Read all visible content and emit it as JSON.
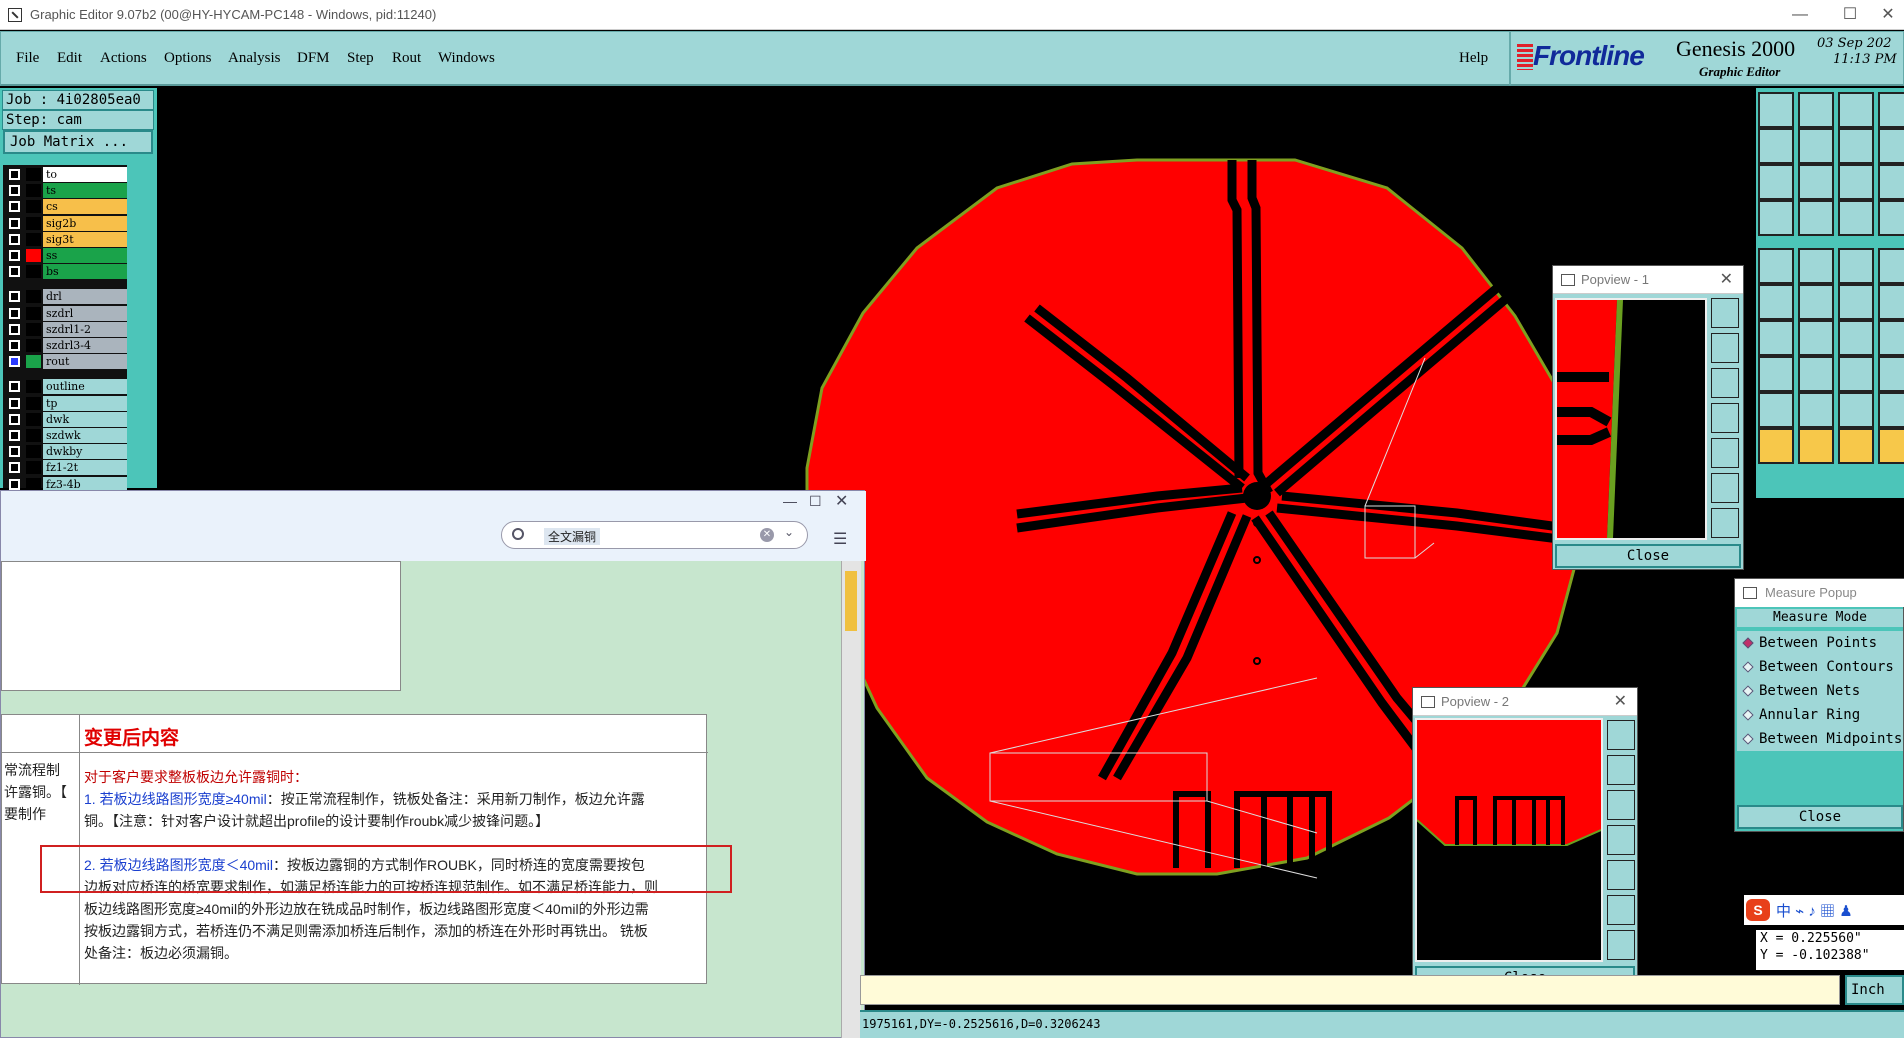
{
  "window": {
    "title": "Graphic Editor 9.07b2 (00@HY-HYCAM-PC148 - Windows, pid:11240)"
  },
  "menu": [
    "File",
    "Edit",
    "Actions",
    "Options",
    "Analysis",
    "DFM",
    "Step",
    "Rout",
    "Windows"
  ],
  "help": "Help",
  "brand": {
    "logo": "Frontline",
    "product": "Genesis 2000",
    "subtitle": "Graphic Editor",
    "date": "03 Sep 202",
    "time": "11:13 PM"
  },
  "job": {
    "job_line": "Job : 4i02805ea0",
    "step_line": "Step: cam",
    "matrix_label": "Job Matrix ..."
  },
  "layers": [
    {
      "name": "to",
      "color": "#ffffff",
      "active": false
    },
    {
      "name": "ts",
      "color": "#1aa34a",
      "active": false
    },
    {
      "name": "cs",
      "color": "#f7bf4a",
      "active": false
    },
    {
      "name": "sig2b",
      "color": "#f7bf4a",
      "active": false
    },
    {
      "name": "sig3t",
      "color": "#f7bf4a",
      "active": false
    },
    {
      "name": "ss",
      "color": "#1aa34a",
      "active": true,
      "marker": "#ff0000"
    },
    {
      "name": "bs",
      "color": "#1aa34a",
      "active": false
    },
    {
      "name": "drl",
      "color": "#aab4bd",
      "active": false
    },
    {
      "name": "szdrl",
      "color": "#aab4bd",
      "active": false
    },
    {
      "name": "szdrl1-2",
      "color": "#aab4bd",
      "active": false
    },
    {
      "name": "szdrl3-4",
      "color": "#aab4bd",
      "active": false
    },
    {
      "name": "rout",
      "color": "#aab4bd",
      "active": true,
      "marker": "#1aa34a"
    },
    {
      "name": "outline",
      "color": "#9fd7d7",
      "active": false
    },
    {
      "name": "tp",
      "color": "#9fd7d7",
      "active": false
    },
    {
      "name": "dwk",
      "color": "#9fd7d7",
      "active": false
    },
    {
      "name": "szdwk",
      "color": "#9fd7d7",
      "active": false
    },
    {
      "name": "dwkby",
      "color": "#9fd7d7",
      "active": false
    },
    {
      "name": "fz1-2t",
      "color": "#9fd7d7",
      "active": false
    },
    {
      "name": "fz3-4b",
      "color": "#9fd7d7",
      "active": false
    }
  ],
  "panel": {
    "search_value": "全文漏铜",
    "header": "变更后内容",
    "left_col": [
      "常流程制",
      "许露铜。【",
      "要制作"
    ],
    "para1_title": "对于客户要求整板板边允许露铜时：",
    "para1_line1_a": "1. 若板边线路图形宽度≥40mil",
    "para1_line1_b": "：按正常流程制作，铣板处备注：采用新刀制作，板边允许露",
    "para1_line2": "铜。【注意：针对客户设计就超出profile的设计要制作roubk减少披锋问题。】",
    "para2_line1_a": "2. 若板边线路图形宽度＜40mil",
    "para2_line1_b": "：按板边露铜的方式制作ROUBK，同时桥连的宽度需要按包",
    "para2_line2": "边板对应桥连的桥宽要求制作，如满足桥连能力的可按桥连规范制作。如不满足桥连能力，则",
    "para2_line3": "板边线路图形宽度≥40mil的外形边放在铣成品时制作，板边线路图形宽度＜40mil的外形边需",
    "para2_line4": "按板边露铜方式，若桥连仍不满足则需添加桥连后制作，添加的桥连在外形时再铣出。  铣板",
    "para2_line5": "处备注：板边必须漏铜。"
  },
  "popview1": {
    "title": "Popview - 1",
    "close": "Close"
  },
  "popview2": {
    "title": "Popview - 2",
    "close": "Close"
  },
  "measure": {
    "title": "Measure Popup",
    "mode_label": "Measure Mode",
    "options": [
      "Between Points",
      "Between Contours",
      "Between Nets",
      "Annular Ring",
      "Between Midpoints"
    ],
    "close": "Close"
  },
  "coords": {
    "x": "X = 0.225560\"",
    "y": "Y = -0.102388\""
  },
  "unit": "Inch",
  "status": "1975161,DY=-0.2525616,D=0.3206243",
  "colors": {
    "copper": "#ff0000",
    "outline": "#7fa020",
    "panel_teal": "#9fd7d7",
    "dark_teal": "#4cc5b9"
  }
}
